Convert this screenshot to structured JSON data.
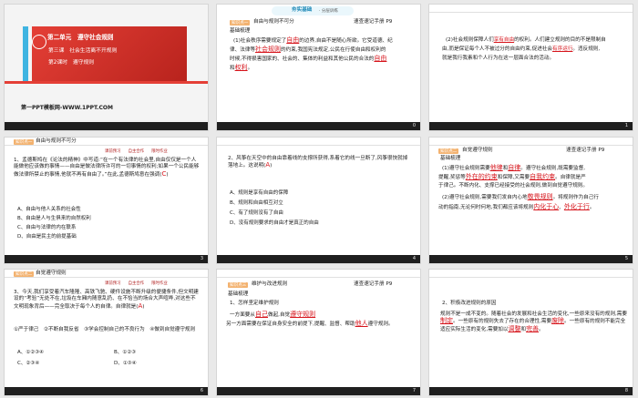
{
  "slides": [
    {
      "number": "",
      "unit": "第二单元　遵守社会规则",
      "lesson": "第三课　社会生活离不开规则",
      "period": "第2课时　遵守规则",
      "url": "第一PPT模板网-WWW.1PPT.COM"
    },
    {
      "number": "0",
      "brand": "夯实基础",
      "brand_sub": "· 分层训练",
      "section_tag": "知识点一",
      "section_title": "自由与规则不可分",
      "ref": "速查速记手册 P9",
      "lines": [
        "基础梳理",
        "(1)社会秩序需要规定了",
        "自由",
        "的边界,自由不是随心所欲。它受道德、纪",
        "律、法律等",
        "社会规则",
        "的约束,我国宪法规定,公民在行使自由和权利的",
        "时候,不得损害国家的、社会的、集体的利益和其他公民的合法的",
        "自由",
        "和",
        "权利",
        "。"
      ]
    },
    {
      "number": "1",
      "lines": [
        "(2)社会规则保障人们",
        "享有自由",
        "的权利。人们建立规则的目的不是限制自",
        "由,而是保证每个人不被过分的自由约束,促进社会",
        "有序运行",
        "。违反规则,",
        "就是我行我素和个人行为在这一层面合法的活动。"
      ]
    },
    {
      "number": "3",
      "header_tag": "知识点一",
      "header_title": "自由与规则不可分",
      "col_tags": [
        "课前预习",
        "自主合作",
        "限时作业"
      ],
      "q": "1、孟德斯鸠在《论法的精神》中写道:“在一个有法律的社会里,自由仅仅是一个人能做他应该做的事情——自由是做法律所许可的一切事情的权利;如果一个公民能够做法律所禁止的事情,他就不再有自由了。”在此,孟德斯鸠意在强调(",
      "answer": "C",
      "options": [
        "A、自由与他人关系的社会性",
        "B、自由是人与生俱来的自然权利",
        "C、自由与法律的内在联系",
        "D、自由是民主的前提基础"
      ]
    },
    {
      "number": "4",
      "q": "2、风筝在天空中的自由靠着线的支撑所获得,系着它的线一旦断了,风筝很快就掉落地上。这说明(",
      "answer": "A",
      "options": [
        "A、规则是享有自由的保障",
        "B、规则和自由相互对立",
        "C、有了规则没有了自由",
        "D、没有规则要求的自由才是真正的自由"
      ]
    },
    {
      "number": "5",
      "section_tag": "知识点二",
      "section_title": "自觉遵守规则",
      "ref": "速查速记手册 P9",
      "lines": [
        "基础梳理",
        "(1)遵守社会规则需要",
        "他律",
        "和",
        "自律",
        "。遵守社会规则,既需要监督,",
        "提醒,奖惩等",
        "外在的约束",
        "和保障,又需要",
        "自我约束",
        "。自律就是严",
        "于律己。不断内化、支撑已经接受的社会规则,做到自觉遵守规则。",
        "(2)遵守社会规则,需要我们发自内心地",
        "敬畏规则",
        "。将规则作为自己行",
        "动的指南,无论何时何地,我们都应该将规则",
        "内化于心",
        "、",
        "外化于行",
        "。"
      ]
    },
    {
      "number": "6",
      "header_tag": "知识点二",
      "header_title": "自觉遵守规则",
      "col_tags": [
        "课前预习",
        "自主合作",
        "限时作业"
      ],
      "q": "3、今天,我们享受着汽车隆隆、高铁飞驰、硬件设施不断升级的便捷条件,但文明建设的“考验”无处不在,垃圾在车厢内随意乱扔、在不恰当的场合大声喧哗,对这些不文明现象背后——完全取决于每个人的自律。自律就是(",
      "answer": "A",
      "sub": "①严于律己　②不断自我反省　③学会控制自己的不良行为　④做到自觉遵守规则",
      "options": [
        "A、①②③④",
        "B、①②③",
        "C、②③④",
        "D、①③④"
      ]
    },
    {
      "number": "7",
      "section_tag": "知识点三",
      "section_title": "维护与改进规则",
      "ref": "速查速记手册 P9",
      "lines": [
        "基础梳理",
        "1、怎样坚定维护规则",
        "一方面要从",
        "自己",
        "做起,自觉",
        "遵守规则",
        "另一方面需要在保证自身安全的前提下,提醒、监督、帮助",
        "他人",
        "遵守规则。"
      ]
    },
    {
      "number": "8",
      "lines": [
        "2、积极改进规则的原因",
        "规则不是一成不变的。随着社会的发展和社会生活的变化,一些原来没有的规则,需要",
        "制定",
        "。一些原有的规则失去了存在的合理性,需要",
        "废除",
        "。一些原有的规则不能完全适应实际生活的变化,需要加以",
        "调整",
        "和",
        "完善",
        "。"
      ]
    }
  ],
  "colors": {
    "accent_red": "#d6141b",
    "hero_red": "#e43f36",
    "accent_blue": "#2ca6d6",
    "footer": "#1f1f1f"
  }
}
